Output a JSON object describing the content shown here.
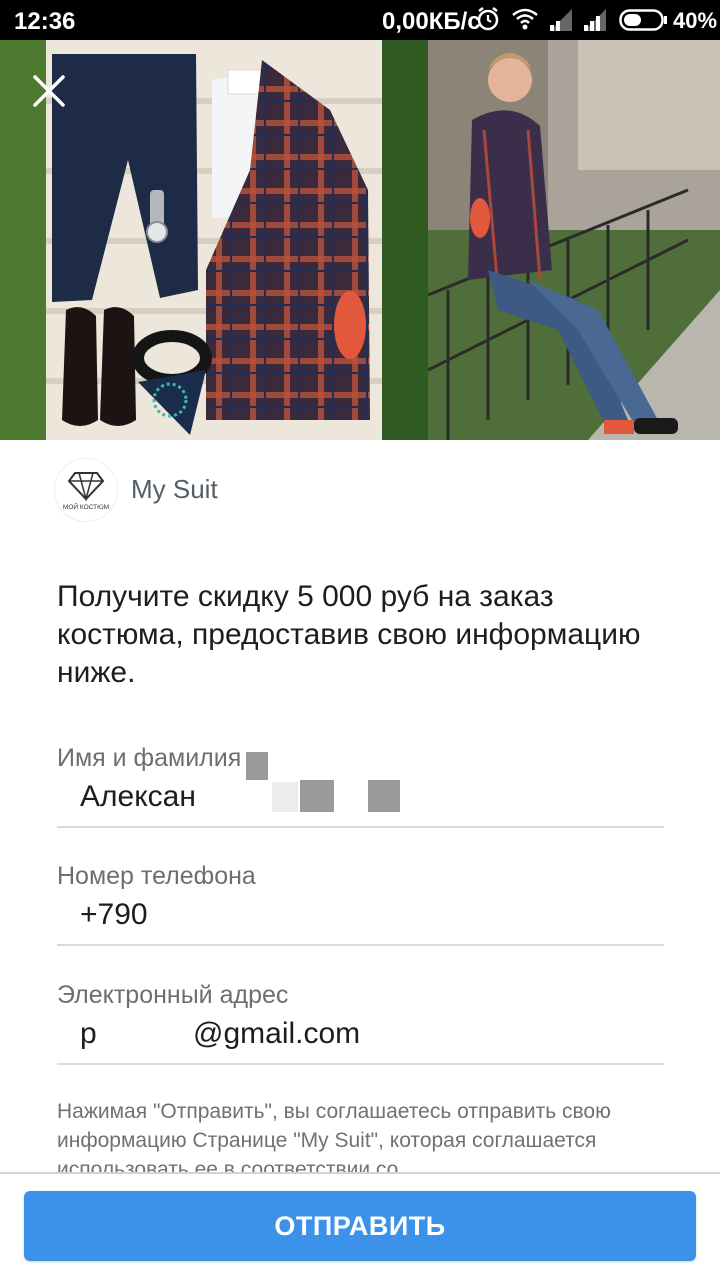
{
  "status_bar": {
    "time": "12:36",
    "network_speed": "0,00КБ/с",
    "battery_percent": "40%"
  },
  "ad": {
    "advertiser_name": "My Suit",
    "logo_text": "МОЙ КОСТЮМ",
    "headline": "Получите скидку 5 000 руб на заказ костюма, предоставив свою информацию ниже."
  },
  "form": {
    "fields": [
      {
        "label": "Имя и фамилия",
        "value": "Алексан"
      },
      {
        "label": "Номер телефона",
        "value": "+790"
      },
      {
        "label": "Электронный адрес",
        "value_prefix": "p",
        "value": "@gmail.com"
      }
    ],
    "disclaimer": "Нажимая \"Отправить\", вы соглашаетесь отправить свою информацию Странице \"My Suit\", которая соглашается использовать ее в соответствии со",
    "submit_label": "ОТПРАВИТЬ"
  },
  "colors": {
    "accent": "#3b92e8",
    "status_bar_bg": "#000000"
  },
  "icons": [
    "close-icon",
    "alarm-icon",
    "wifi-icon",
    "signal-icon",
    "battery-icon"
  ]
}
